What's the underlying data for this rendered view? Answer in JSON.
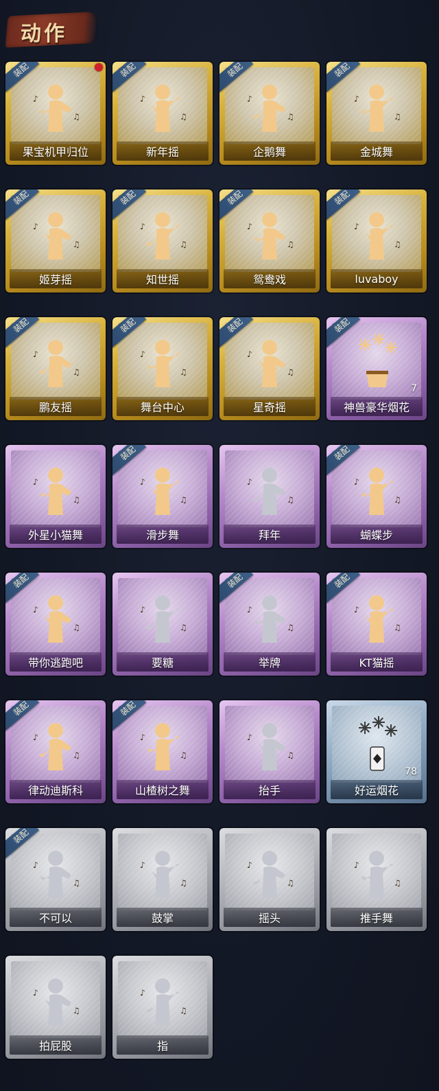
{
  "header": {
    "title": "动作"
  },
  "equip_label": "装配",
  "colors": {
    "gold": "#d9b440",
    "purple": "#b88ccc",
    "blue": "#94aec6",
    "grey": "#b5b7bd",
    "equip_tag": "#2d4a6e",
    "new_dot": "#d0202a",
    "icon_gold": "#f2c98a",
    "icon_grey": "#c4c7cf"
  },
  "emotes": [
    {
      "name": "果宝机甲归位",
      "tier": "gold",
      "equipped": true,
      "new": true,
      "icon": "pose-hands-on-hips-icon"
    },
    {
      "name": "新年摇",
      "tier": "gold",
      "equipped": true,
      "new": false,
      "icon": "pose-wave-icon"
    },
    {
      "name": "企鹅舞",
      "tier": "gold",
      "equipped": true,
      "new": false,
      "icon": "pose-penguin-icon"
    },
    {
      "name": "金城舞",
      "tier": "gold",
      "equipped": true,
      "new": false,
      "icon": "pose-dance-icon"
    },
    {
      "name": "姬芽摇",
      "tier": "gold",
      "equipped": true,
      "new": false,
      "icon": "pose-sway-icon"
    },
    {
      "name": "知世摇",
      "tier": "gold",
      "equipped": true,
      "new": false,
      "icon": "pose-sway-icon"
    },
    {
      "name": "鸳鸯戏",
      "tier": "gold",
      "equipped": true,
      "new": false,
      "icon": "pose-dance-icon"
    },
    {
      "name": "luvaboy",
      "tier": "gold",
      "equipped": true,
      "new": false,
      "icon": "pose-cross-arms-icon"
    },
    {
      "name": "鹏友摇",
      "tier": "gold",
      "equipped": true,
      "new": false,
      "icon": "pose-sway-icon"
    },
    {
      "name": "舞台中心",
      "tier": "gold",
      "equipped": true,
      "new": false,
      "icon": "pose-stage-icon"
    },
    {
      "name": "星奇摇",
      "tier": "gold",
      "equipped": true,
      "new": false,
      "icon": "pose-punch-icon"
    },
    {
      "name": "神兽豪华烟花",
      "tier": "purple",
      "equipped": true,
      "new": false,
      "count": "7",
      "icon": "fireworks-pot-icon"
    },
    {
      "name": "外星小猫舞",
      "tier": "purple",
      "equipped": false,
      "new": false,
      "icon": "pose-cat-dance-icon"
    },
    {
      "name": "滑步舞",
      "tier": "purple",
      "equipped": true,
      "new": false,
      "icon": "pose-slide-icon"
    },
    {
      "name": "拜年",
      "tier": "purple",
      "equipped": false,
      "new": false,
      "locked": true,
      "icon": "pose-bow-icon"
    },
    {
      "name": "蝴蝶步",
      "tier": "purple",
      "equipped": true,
      "new": false,
      "icon": "pose-butterfly-icon"
    },
    {
      "name": "带你逃跑吧",
      "tier": "purple",
      "equipped": true,
      "new": false,
      "icon": "pose-point-icon"
    },
    {
      "name": "要糖",
      "tier": "purple",
      "equipped": false,
      "new": false,
      "locked": true,
      "icon": "pose-ask-icon"
    },
    {
      "name": "举牌",
      "tier": "purple",
      "equipped": true,
      "new": false,
      "locked": true,
      "icon": "pose-sign-icon"
    },
    {
      "name": "KT猫摇",
      "tier": "purple",
      "equipped": true,
      "new": false,
      "icon": "pose-sway-icon"
    },
    {
      "name": "律动迪斯科",
      "tier": "purple",
      "equipped": true,
      "new": false,
      "icon": "pose-disco-icon"
    },
    {
      "name": "山楂树之舞",
      "tier": "purple",
      "equipped": true,
      "new": false,
      "icon": "pose-raise-arm-icon"
    },
    {
      "name": "抬手",
      "tier": "purple",
      "equipped": false,
      "new": false,
      "locked": true,
      "icon": "pose-lift-hand-icon"
    },
    {
      "name": "好运烟花",
      "tier": "blue",
      "equipped": false,
      "new": false,
      "count": "78",
      "icon": "firework-can-icon"
    },
    {
      "name": "不可以",
      "tier": "grey",
      "equipped": true,
      "new": false,
      "locked": true,
      "icon": "finger-wag-icon"
    },
    {
      "name": "鼓掌",
      "tier": "grey",
      "equipped": false,
      "new": false,
      "locked": true,
      "icon": "clap-hands-icon"
    },
    {
      "name": "摇头",
      "tier": "grey",
      "equipped": false,
      "new": false,
      "locked": true,
      "icon": "pose-shake-head-icon"
    },
    {
      "name": "推手舞",
      "tier": "grey",
      "equipped": false,
      "new": false,
      "locked": true,
      "icon": "pose-push-hand-icon"
    },
    {
      "name": "拍屁股",
      "tier": "grey",
      "equipped": false,
      "new": false,
      "locked": true,
      "icon": "pose-bend-icon"
    },
    {
      "name": "指",
      "tier": "grey",
      "equipped": false,
      "new": false,
      "locked": true,
      "icon": "point-hand-icon"
    }
  ]
}
